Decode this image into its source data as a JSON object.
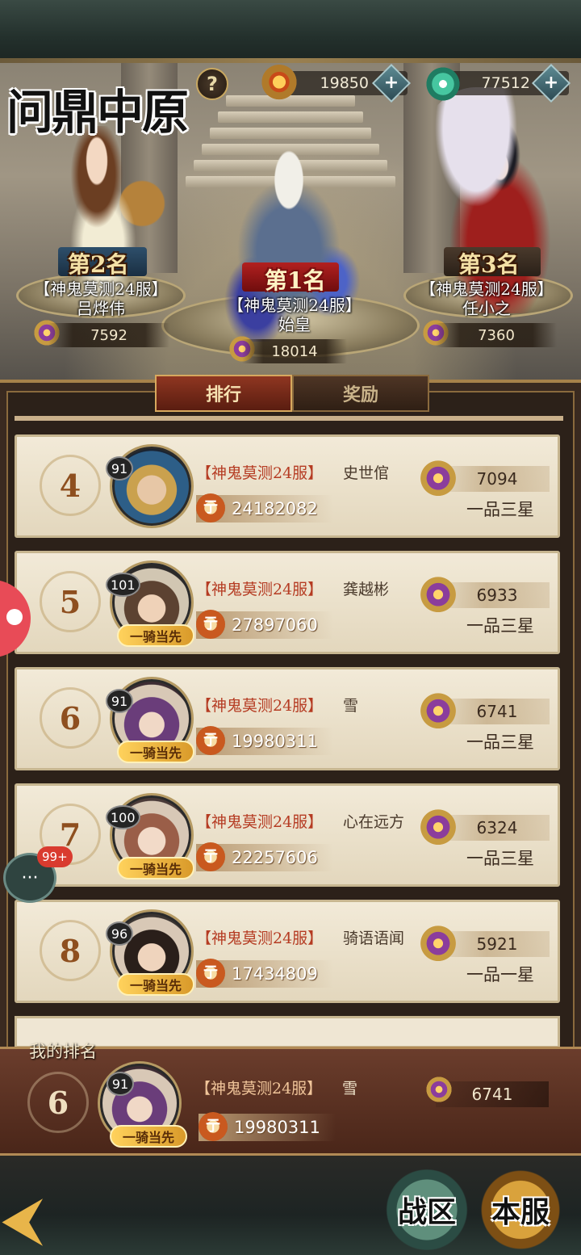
{
  "header": {
    "logo_text": "问鼎中原",
    "help_label": "?",
    "currency_1": "19850",
    "currency_2": "77512",
    "plus_label": "+"
  },
  "podium": [
    {
      "rank_label": "第1名",
      "server": "【神鬼莫测24服】",
      "name": "始皇",
      "power": "18014"
    },
    {
      "rank_label": "第2名",
      "server": "【神鬼莫测24服】",
      "name": "吕烨伟",
      "power": "7592"
    },
    {
      "rank_label": "第3名",
      "server": "【神鬼莫测24服】",
      "name": "任小之",
      "power": "7360"
    }
  ],
  "tabs": {
    "rank": "排行",
    "reward": "奖励"
  },
  "list": [
    {
      "rank": "4",
      "level": "91",
      "server": "【神鬼莫测24服】",
      "name": "史世倌",
      "power": "24182082",
      "score": "7094",
      "title": "一品三星",
      "cavalry": ""
    },
    {
      "rank": "5",
      "level": "101",
      "server": "【神鬼莫测24服】",
      "name": "龚越彬",
      "power": "27897060",
      "score": "6933",
      "title": "一品三星",
      "cavalry": "一骑当先"
    },
    {
      "rank": "6",
      "level": "91",
      "server": "【神鬼莫测24服】",
      "name": "雪",
      "power": "19980311",
      "score": "6741",
      "title": "一品三星",
      "cavalry": "一骑当先"
    },
    {
      "rank": "7",
      "level": "100",
      "server": "【神鬼莫测24服】",
      "name": "心在远方",
      "power": "22257606",
      "score": "6324",
      "title": "一品三星",
      "cavalry": "一骑当先"
    },
    {
      "rank": "8",
      "level": "96",
      "server": "【神鬼莫测24服】",
      "name": "骑语语闻",
      "power": "17434809",
      "score": "5921",
      "title": "一品一星",
      "cavalry": "一骑当先"
    }
  ],
  "my_rank": {
    "label": "我的排名",
    "rank": "6",
    "level": "91",
    "server": "【神鬼莫测24服】",
    "name": "雪",
    "power": "19980311",
    "score": "6741",
    "cavalry": "一骑当先"
  },
  "power_icon_glyph": "亍",
  "bottom": {
    "back_glyph": "⮜",
    "zone_button": "战区",
    "server_button": "本服"
  },
  "chat": {
    "badge": "99+",
    "glyph": "···"
  }
}
